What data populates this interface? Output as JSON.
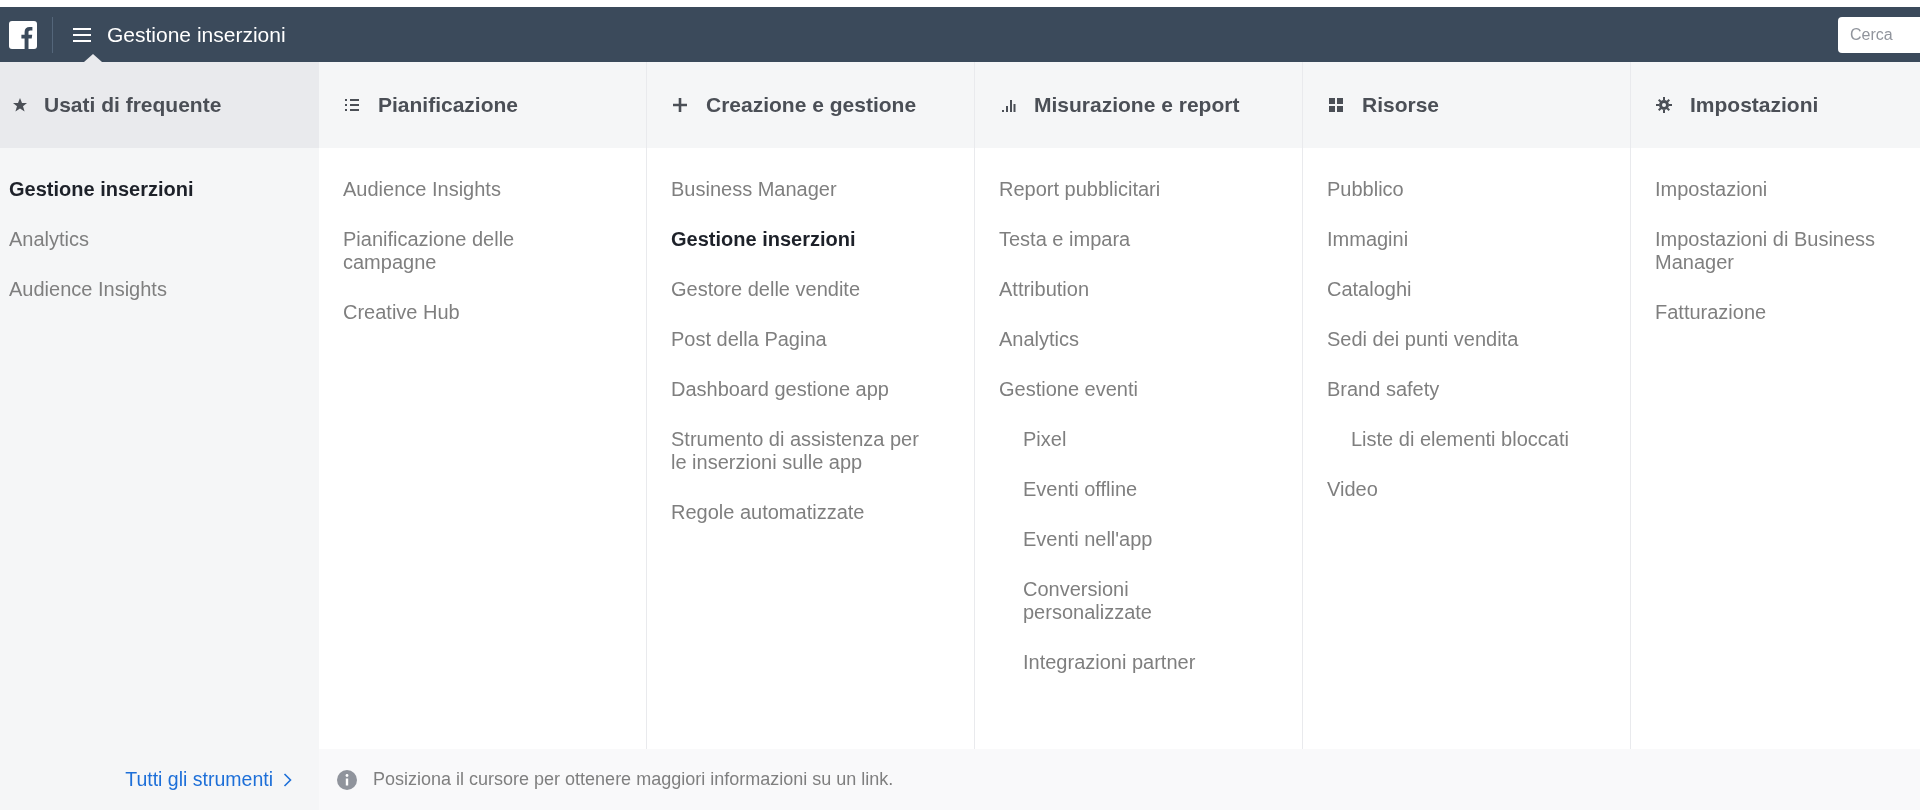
{
  "topbar": {
    "title": "Gestione inserzioni",
    "search": {
      "placeholder": "Cerca"
    }
  },
  "columns": [
    {
      "title": "Usati di frequente",
      "selected": true,
      "items": [
        {
          "label": "Gestione inserzioni",
          "selected": true
        },
        {
          "label": "Analytics",
          "selected": false
        },
        {
          "label": "Audience Insights",
          "selected": false
        }
      ]
    },
    {
      "title": "Pianificazione",
      "selected": false,
      "items": [
        {
          "label": "Audience Insights",
          "selected": false
        },
        {
          "label": "Pianificazione delle\ncampagne",
          "selected": false
        },
        {
          "label": "Creative Hub",
          "selected": false
        }
      ]
    },
    {
      "title": "Creazione e gestione",
      "selected": false,
      "items": [
        {
          "label": "Business Manager",
          "selected": false
        },
        {
          "label": "Gestione inserzioni",
          "selected": true
        },
        {
          "label": "Gestore delle vendite",
          "selected": false
        },
        {
          "label": "Post della Pagina",
          "selected": false
        },
        {
          "label": "Dashboard gestione app",
          "selected": false
        },
        {
          "label": "Strumento di assistenza per\nle inserzioni sulle app",
          "selected": false
        },
        {
          "label": "Regole automatizzate",
          "selected": false
        }
      ]
    },
    {
      "title": "Misurazione e report",
      "selected": false,
      "items": [
        {
          "label": "Report pubblicitari",
          "selected": false
        },
        {
          "label": "Testa e impara",
          "selected": false
        },
        {
          "label": "Attribution",
          "selected": false
        },
        {
          "label": "Analytics",
          "selected": false
        },
        {
          "label": "Gestione eventi",
          "selected": false,
          "children": [
            {
              "label": "Pixel",
              "selected": false
            },
            {
              "label": "Eventi offline",
              "selected": false
            },
            {
              "label": "Eventi nell'app",
              "selected": false
            },
            {
              "label": "Conversioni\npersonalizzate",
              "selected": false
            },
            {
              "label": "Integrazioni partner",
              "selected": false
            }
          ]
        }
      ]
    },
    {
      "title": "Risorse",
      "selected": false,
      "items": [
        {
          "label": "Pubblico",
          "selected": false
        },
        {
          "label": "Immagini",
          "selected": false
        },
        {
          "label": "Cataloghi",
          "selected": false
        },
        {
          "label": "Sedi dei punti vendita",
          "selected": false
        },
        {
          "label": "Brand safety",
          "selected": false,
          "children": [
            {
              "label": "Liste di elementi bloccati",
              "selected": false
            }
          ]
        },
        {
          "label": "Video",
          "selected": false
        }
      ]
    },
    {
      "title": "Impostazioni",
      "selected": false,
      "items": [
        {
          "label": "Impostazioni",
          "selected": false
        },
        {
          "label": "Impostazioni di Business\nManager",
          "selected": false
        },
        {
          "label": "Fatturazione",
          "selected": false
        }
      ]
    }
  ],
  "footer": {
    "link": "Tutti gli strumenti",
    "hint": "Posiziona il cursore per ottenere maggiori informazioni su un link."
  }
}
